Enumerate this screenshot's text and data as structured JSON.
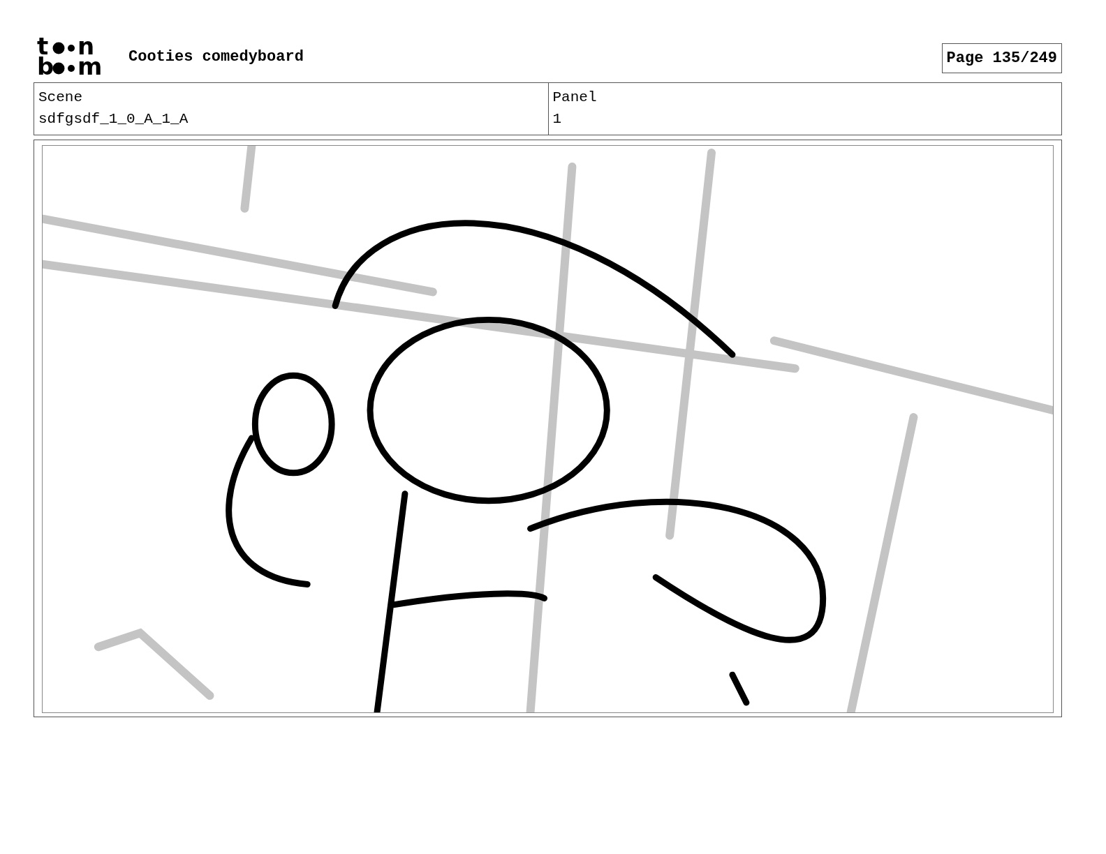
{
  "logo": {
    "rows": [
      {
        "first": "t",
        "last": "n"
      },
      {
        "first": "b",
        "last": "m"
      }
    ]
  },
  "header": {
    "title": "Cooties comedyboard",
    "page": "Page 135/249"
  },
  "info": [
    {
      "label": "Scene",
      "value": "sdfgsdf_1_0_A_1_A"
    },
    {
      "label": "Panel",
      "value": "1"
    }
  ]
}
